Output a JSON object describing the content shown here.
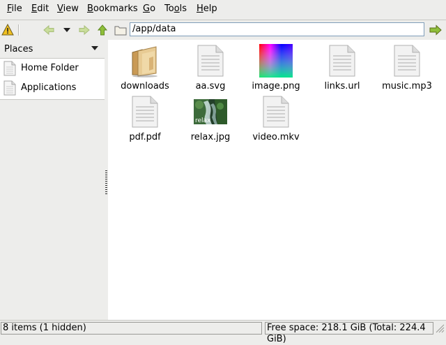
{
  "menubar": {
    "items": [
      {
        "pre": "",
        "u": "F",
        "post": "ile"
      },
      {
        "pre": "",
        "u": "E",
        "post": "dit"
      },
      {
        "pre": "",
        "u": "V",
        "post": "iew"
      },
      {
        "pre": "",
        "u": "B",
        "post": "ookmarks"
      },
      {
        "pre": "",
        "u": "G",
        "post": "o"
      },
      {
        "pre": "To",
        "u": "o",
        "post": "ls"
      },
      {
        "pre": "",
        "u": "H",
        "post": "elp"
      }
    ]
  },
  "toolbar": {
    "path": "/app/data",
    "icons": [
      "warning-icon",
      "back-icon",
      "history-dropdown-icon",
      "forward-icon",
      "up-icon",
      "folder-icon",
      "go-icon"
    ]
  },
  "sidebar": {
    "header": "Places",
    "items": [
      {
        "label": "Home Folder",
        "icon": "document-icon"
      },
      {
        "label": "Applications",
        "icon": "document-icon"
      }
    ]
  },
  "files": [
    {
      "name": "downloads",
      "icon": "folder-icon"
    },
    {
      "name": "aa.svg",
      "icon": "document-icon"
    },
    {
      "name": "image.png",
      "icon": "image-thumbnail-icon"
    },
    {
      "name": "links.url",
      "icon": "document-icon"
    },
    {
      "name": "music.mp3",
      "icon": "document-icon"
    },
    {
      "name": "pdf.pdf",
      "icon": "document-icon"
    },
    {
      "name": "relax.jpg",
      "icon": "photo-thumbnail-icon",
      "thumb_text": "relax"
    },
    {
      "name": "video.mkv",
      "icon": "document-icon"
    }
  ],
  "statusbar": {
    "items": "8 items (1 hidden)",
    "free_space": "Free space: 218.1 GiB (Total: 224.4 GiB)"
  },
  "colors": {
    "background": "#ededeb",
    "folder": "#d9b77a",
    "path_border": "#7f9db9",
    "arrow_green": "#8fbf3a"
  }
}
